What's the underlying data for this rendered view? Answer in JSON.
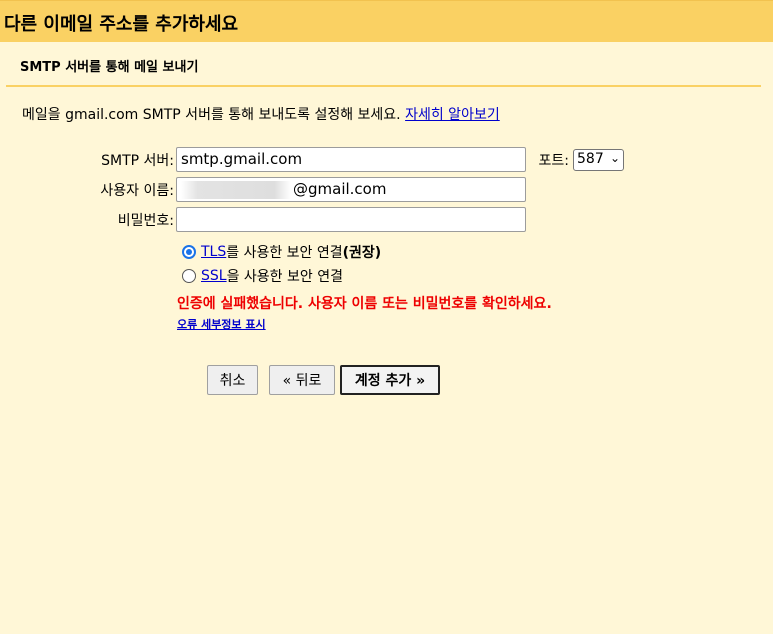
{
  "header": {
    "title": "다른 이메일 주소를 추가하세요"
  },
  "section": {
    "subtitle": "SMTP 서버를 통해 메일 보내기",
    "description": "메일을 gmail.com SMTP 서버를 통해 보내도록 설정해 보세요.",
    "learn_more": "자세히 알아보기"
  },
  "form": {
    "smtp_label": "SMTP 서버:",
    "smtp_value": "smtp.gmail.com",
    "port_label": "포트:",
    "port_value": "587",
    "username_label": "사용자 이름:",
    "username_value": "@gmail.com",
    "password_label": "비밀번호:",
    "password_value": ""
  },
  "security": {
    "tls_link": "TLS",
    "tls_text": "를 사용한 보안 연결",
    "tls_recommended": "(권장)",
    "tls_checked": true,
    "ssl_link": "SSL",
    "ssl_text": "을 사용한 보안 연결",
    "ssl_checked": false
  },
  "error": {
    "message": "인증에 실패했습니다. 사용자 이름 또는 비밀번호를 확인하세요.",
    "details_link": "오류 세부정보 표시"
  },
  "buttons": {
    "cancel": "취소",
    "back": "« 뒤로",
    "add_account": "계정 추가 »"
  },
  "colors": {
    "header_bg": "#fad163",
    "page_bg": "#fff7d7",
    "error": "#ee0000",
    "link": "#0000cc",
    "radio_accent": "#1a73e8"
  }
}
